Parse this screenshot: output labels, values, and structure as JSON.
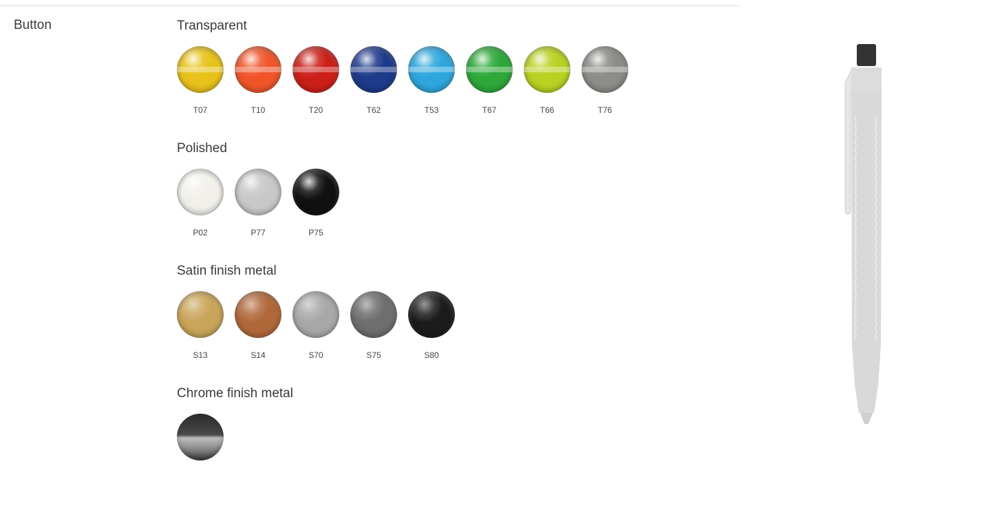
{
  "section": {
    "label": "Button"
  },
  "groups": [
    {
      "title": "Transparent",
      "finish": "transparent",
      "swatches": [
        {
          "code": "T07",
          "color": "#e8c21a"
        },
        {
          "code": "T10",
          "color": "#f0552a"
        },
        {
          "code": "T20",
          "color": "#cc1f1a"
        },
        {
          "code": "T62",
          "color": "#1e3a8a"
        },
        {
          "code": "T53",
          "color": "#2ea6dd"
        },
        {
          "code": "T67",
          "color": "#2ea83a"
        },
        {
          "code": "T66",
          "color": "#b8d122"
        },
        {
          "code": "T76",
          "color": "#8c8c88"
        }
      ]
    },
    {
      "title": "Polished",
      "finish": "polished",
      "swatches": [
        {
          "code": "P02",
          "color": "#f2f0ea"
        },
        {
          "code": "P77",
          "color": "#c8c8c8"
        },
        {
          "code": "P75",
          "color": "#111111"
        }
      ]
    },
    {
      "title": "Satin finish metal",
      "finish": "satin",
      "swatches": [
        {
          "code": "S13",
          "color": "#c9a55a"
        },
        {
          "code": "S14",
          "color": "#b0683a"
        },
        {
          "code": "S70",
          "color": "#a8a8a8"
        },
        {
          "code": "S75",
          "color": "#6e6e6e"
        },
        {
          "code": "S80",
          "color": "#1c1c1c"
        }
      ]
    },
    {
      "title": "Chrome finish metal",
      "finish": "chrome",
      "swatches": [
        {
          "code": "",
          "color": "#555555"
        }
      ]
    }
  ],
  "product": {
    "icon": "pen-preview",
    "body_color": "#d9d9d9",
    "button_color": "#333333"
  }
}
